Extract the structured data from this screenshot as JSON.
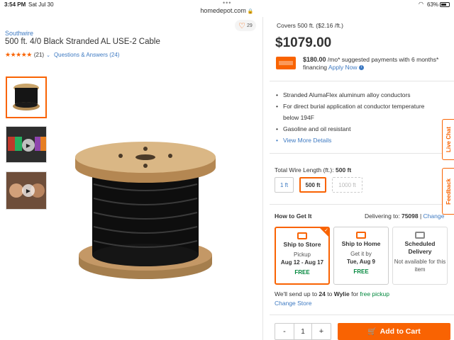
{
  "status_bar": {
    "time": "3:54 PM",
    "date": "Sat Jul 30",
    "battery": "63%"
  },
  "browser": {
    "url": "homedepot.com"
  },
  "product": {
    "brand": "Southwire",
    "title": "500 ft. 4/0 Black Stranded AL USE-2 Cable",
    "stars": "★★★★★",
    "review_count": "(21)",
    "qa_link": "Questions & Answers (24)",
    "favorite_count": "29"
  },
  "pricing": {
    "covers": "Covers 500 ft. ($2.16 /ft.)",
    "price": "$1079.00",
    "finance_amount": "$180.00",
    "finance_text": " /mo* suggested payments with 6 months* financing ",
    "apply_now": "Apply Now"
  },
  "highlights": [
    "Stranded AlumaFlex aluminum alloy conductors",
    "For direct burial application at conductor temperature below 194F",
    "Gasoline and oil resistant",
    "View More Details"
  ],
  "length": {
    "label": "Total Wire Length (ft.): ",
    "selected": "500 ft",
    "options": [
      "1 ft",
      "500 ft",
      "1000 ft"
    ]
  },
  "how_to_get": {
    "heading": "How to Get It",
    "delivering_label": "Delivering to: ",
    "zip": "75098",
    "separator": " | ",
    "change": "Change",
    "options": [
      {
        "title": "Ship to Store",
        "line1": "Pickup",
        "line2": "Aug 12 - Aug 17",
        "price": "FREE"
      },
      {
        "title": "Ship to Home",
        "line1": "Get it by",
        "line2": "Tue, Aug 9",
        "price": "FREE"
      },
      {
        "title": "Scheduled Delivery",
        "line1": "Not available for this item",
        "line2": "",
        "price": ""
      }
    ],
    "sendup_prefix": "We'll send up to ",
    "sendup_qty": "24",
    "sendup_to": " to ",
    "store": "Wylie",
    "sendup_for": " for ",
    "free_pickup": "free pickup",
    "change_store": "Change Store"
  },
  "cart": {
    "qty_minus": "-",
    "qty_value": "1",
    "qty_plus": "+",
    "add_label": "Add to Cart"
  },
  "side_tabs": {
    "live_chat": "Live Chat",
    "feedback": "Feedback"
  },
  "colors": {
    "accent": "#f96302",
    "link": "#3e7ac2",
    "free": "#00873c"
  }
}
